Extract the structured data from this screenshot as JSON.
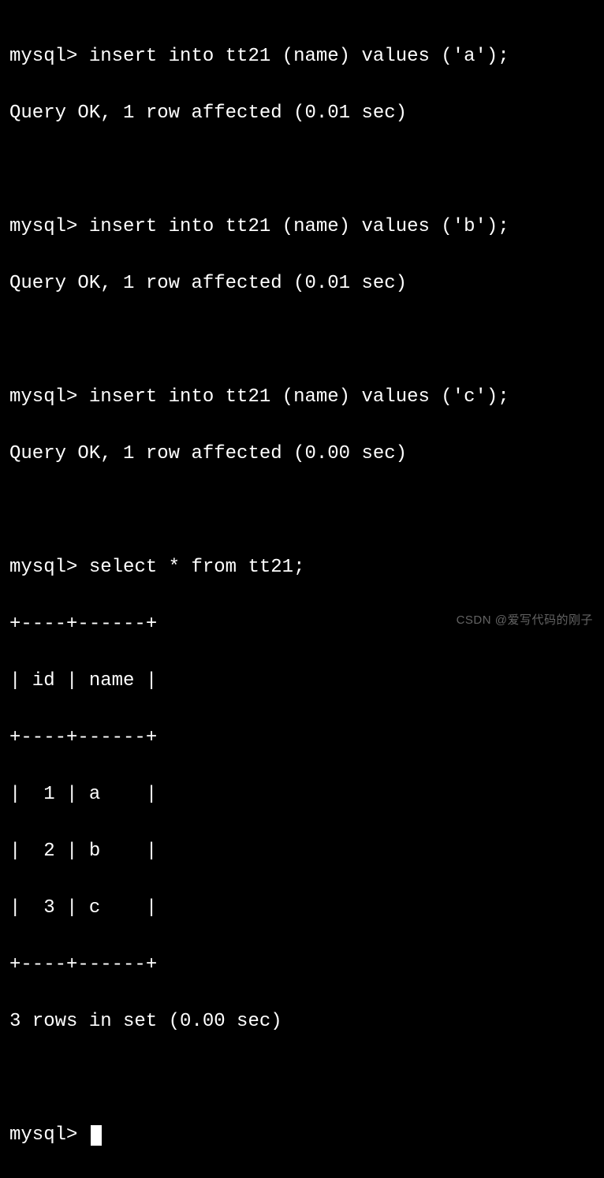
{
  "prompt": "mysql>",
  "blocks": [
    {
      "cmd": "insert into tt21 (name) values ('a');",
      "result": "Query OK, 1 row affected (0.01 sec)"
    },
    {
      "cmd": "insert into tt21 (name) values ('b');",
      "result": "Query OK, 1 row affected (0.01 sec)"
    },
    {
      "cmd": "insert into tt21 (name) values ('c');",
      "result": "Query OK, 1 row affected (0.00 sec)"
    }
  ],
  "select": {
    "cmd": "select * from tt21;",
    "border_top": "+----+------+",
    "header": "| id | name |",
    "border_mid": "+----+------+",
    "rows": [
      "|  1 | a    |",
      "|  2 | b    |",
      "|  3 | c    |"
    ],
    "border_bot": "+----+------+",
    "summary": "3 rows in set (0.00 sec)"
  },
  "watermark": "CSDN @爱写代码的刚子"
}
